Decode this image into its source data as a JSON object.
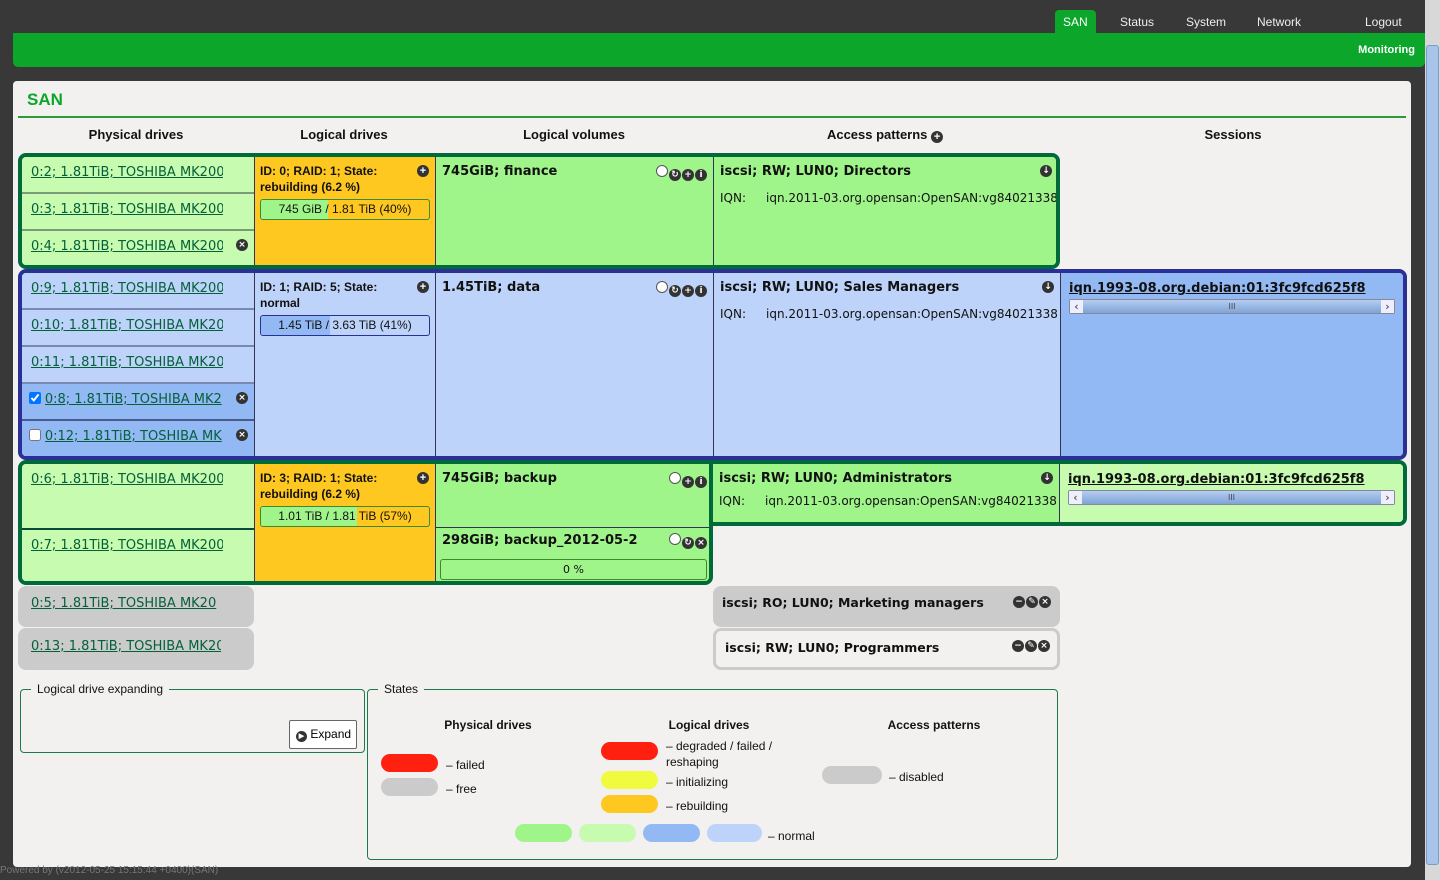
{
  "nav": {
    "tabs": [
      "SAN",
      "Status",
      "System",
      "Network"
    ],
    "active": "SAN",
    "logout": "Logout",
    "subnav": "Monitoring"
  },
  "page": {
    "title": "SAN"
  },
  "columns": [
    "Physical drives",
    "Logical drives",
    "Logical volumes",
    "Access patterns",
    "Sessions"
  ],
  "groups": [
    {
      "physical": [
        "0:2; 1.81TiB; TOSHIBA MK200",
        "0:3; 1.81TiB; TOSHIBA MK200",
        "0:4; 1.81TiB; TOSHIBA MK200"
      ],
      "logical": {
        "text": "ID: 0; RAID: 1; State: rebuilding (6.2 %)",
        "bar": "745 GiB / 1.81 TiB (40%)",
        "percent": 40
      },
      "volumes": [
        {
          "text": "745GiB; finance"
        }
      ],
      "access": {
        "text": "iscsi; RW; LUN0; Directors",
        "iqn_label": "IQN:",
        "iqn": "iqn.2011-03.org.opensan:OpenSAN:vg84021338"
      }
    },
    {
      "physical": [
        "0:9; 1.81TiB; TOSHIBA MK200",
        "0:10; 1.81TiB; TOSHIBA MK20",
        "0:11; 1.81TiB; TOSHIBA MK20",
        "0:8; 1.81TiB; TOSHIBA MK2",
        "0:12; 1.81TiB; TOSHIBA MK"
      ],
      "checkboxes": [
        true,
        false
      ],
      "logical": {
        "text": "ID: 1; RAID: 5; State: normal",
        "bar": "1.45 TiB / 3.63 TiB (41%)",
        "percent": 41
      },
      "volumes": [
        {
          "text": "1.45TiB; data"
        }
      ],
      "access": {
        "text": "iscsi; RW; LUN0; Sales Managers",
        "iqn_label": "IQN:",
        "iqn": "iqn.2011-03.org.opensan:OpenSAN:vg84021338"
      },
      "session": "iqn.1993-08.org.debian:01:3fc9fcd625f8"
    },
    {
      "physical": [
        "0:6; 1.81TiB; TOSHIBA MK200",
        "0:7; 1.81TiB; TOSHIBA MK200"
      ],
      "logical": {
        "text": "ID: 3; RAID: 1; State: rebuilding (6.2 %)",
        "bar": "1.01 TiB / 1.81 TiB (57%)",
        "percent": 57
      },
      "volumes": [
        {
          "text": "745GiB; backup"
        },
        {
          "text": "298GiB; backup_2012-05-2",
          "bar": "0 %",
          "percent": 0
        }
      ],
      "access": {
        "text": "iscsi; RW; LUN0; Administrators",
        "iqn_label": "IQN:",
        "iqn": "iqn.2011-03.org.opensan:OpenSAN:vg84021338"
      },
      "session": "iqn.1993-08.org.debian:01:3fc9fcd625f8"
    }
  ],
  "free_drives": [
    "0:5; 1.81TiB; TOSHIBA MK20",
    "0:13; 1.81TiB; TOSHIBA MK20"
  ],
  "other_access": [
    "iscsi; RO; LUN0; Marketing managers",
    "iscsi; RW; LUN0; Programmers"
  ],
  "expanding": {
    "legend": "Logical drive expanding",
    "button": "Expand"
  },
  "states": {
    "legend": "States",
    "physical": {
      "title": "Physical drives",
      "failed": "– failed",
      "free": "– free"
    },
    "logical": {
      "title": "Logical drives",
      "degraded": "– degraded / failed / reshaping",
      "initializing": "– initializing",
      "rebuilding": "– rebuilding"
    },
    "access": {
      "title": "Access patterns",
      "disabled": "– disabled"
    },
    "normal": "– normal"
  },
  "colors": {
    "brand": "#0ca72a",
    "failed": "#ff2010",
    "free": "#cbcbcb",
    "initializing": "#f0fb40",
    "rebuilding": "#ffc820",
    "normal": [
      "#a0f58a",
      "#c6fbb0",
      "#93b9f5",
      "#bdd3fa"
    ]
  },
  "footer": "Powered by (v2012-05-25 15:15:44 +0400)(SAN)"
}
